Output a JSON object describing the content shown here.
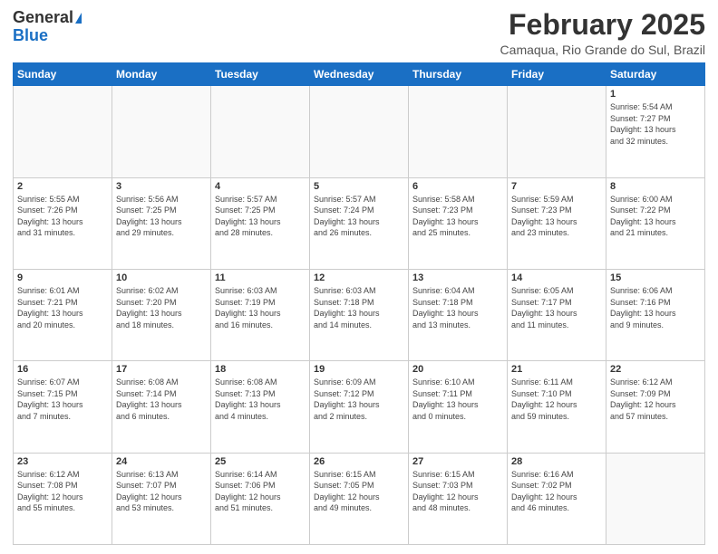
{
  "header": {
    "logo_line1": "General",
    "logo_line2": "Blue",
    "month": "February 2025",
    "location": "Camaqua, Rio Grande do Sul, Brazil"
  },
  "weekdays": [
    "Sunday",
    "Monday",
    "Tuesday",
    "Wednesday",
    "Thursday",
    "Friday",
    "Saturday"
  ],
  "weeks": [
    [
      {
        "day": "",
        "info": ""
      },
      {
        "day": "",
        "info": ""
      },
      {
        "day": "",
        "info": ""
      },
      {
        "day": "",
        "info": ""
      },
      {
        "day": "",
        "info": ""
      },
      {
        "day": "",
        "info": ""
      },
      {
        "day": "1",
        "info": "Sunrise: 5:54 AM\nSunset: 7:27 PM\nDaylight: 13 hours\nand 32 minutes."
      }
    ],
    [
      {
        "day": "2",
        "info": "Sunrise: 5:55 AM\nSunset: 7:26 PM\nDaylight: 13 hours\nand 31 minutes."
      },
      {
        "day": "3",
        "info": "Sunrise: 5:56 AM\nSunset: 7:25 PM\nDaylight: 13 hours\nand 29 minutes."
      },
      {
        "day": "4",
        "info": "Sunrise: 5:57 AM\nSunset: 7:25 PM\nDaylight: 13 hours\nand 28 minutes."
      },
      {
        "day": "5",
        "info": "Sunrise: 5:57 AM\nSunset: 7:24 PM\nDaylight: 13 hours\nand 26 minutes."
      },
      {
        "day": "6",
        "info": "Sunrise: 5:58 AM\nSunset: 7:23 PM\nDaylight: 13 hours\nand 25 minutes."
      },
      {
        "day": "7",
        "info": "Sunrise: 5:59 AM\nSunset: 7:23 PM\nDaylight: 13 hours\nand 23 minutes."
      },
      {
        "day": "8",
        "info": "Sunrise: 6:00 AM\nSunset: 7:22 PM\nDaylight: 13 hours\nand 21 minutes."
      }
    ],
    [
      {
        "day": "9",
        "info": "Sunrise: 6:01 AM\nSunset: 7:21 PM\nDaylight: 13 hours\nand 20 minutes."
      },
      {
        "day": "10",
        "info": "Sunrise: 6:02 AM\nSunset: 7:20 PM\nDaylight: 13 hours\nand 18 minutes."
      },
      {
        "day": "11",
        "info": "Sunrise: 6:03 AM\nSunset: 7:19 PM\nDaylight: 13 hours\nand 16 minutes."
      },
      {
        "day": "12",
        "info": "Sunrise: 6:03 AM\nSunset: 7:18 PM\nDaylight: 13 hours\nand 14 minutes."
      },
      {
        "day": "13",
        "info": "Sunrise: 6:04 AM\nSunset: 7:18 PM\nDaylight: 13 hours\nand 13 minutes."
      },
      {
        "day": "14",
        "info": "Sunrise: 6:05 AM\nSunset: 7:17 PM\nDaylight: 13 hours\nand 11 minutes."
      },
      {
        "day": "15",
        "info": "Sunrise: 6:06 AM\nSunset: 7:16 PM\nDaylight: 13 hours\nand 9 minutes."
      }
    ],
    [
      {
        "day": "16",
        "info": "Sunrise: 6:07 AM\nSunset: 7:15 PM\nDaylight: 13 hours\nand 7 minutes."
      },
      {
        "day": "17",
        "info": "Sunrise: 6:08 AM\nSunset: 7:14 PM\nDaylight: 13 hours\nand 6 minutes."
      },
      {
        "day": "18",
        "info": "Sunrise: 6:08 AM\nSunset: 7:13 PM\nDaylight: 13 hours\nand 4 minutes."
      },
      {
        "day": "19",
        "info": "Sunrise: 6:09 AM\nSunset: 7:12 PM\nDaylight: 13 hours\nand 2 minutes."
      },
      {
        "day": "20",
        "info": "Sunrise: 6:10 AM\nSunset: 7:11 PM\nDaylight: 13 hours\nand 0 minutes."
      },
      {
        "day": "21",
        "info": "Sunrise: 6:11 AM\nSunset: 7:10 PM\nDaylight: 12 hours\nand 59 minutes."
      },
      {
        "day": "22",
        "info": "Sunrise: 6:12 AM\nSunset: 7:09 PM\nDaylight: 12 hours\nand 57 minutes."
      }
    ],
    [
      {
        "day": "23",
        "info": "Sunrise: 6:12 AM\nSunset: 7:08 PM\nDaylight: 12 hours\nand 55 minutes."
      },
      {
        "day": "24",
        "info": "Sunrise: 6:13 AM\nSunset: 7:07 PM\nDaylight: 12 hours\nand 53 minutes."
      },
      {
        "day": "25",
        "info": "Sunrise: 6:14 AM\nSunset: 7:06 PM\nDaylight: 12 hours\nand 51 minutes."
      },
      {
        "day": "26",
        "info": "Sunrise: 6:15 AM\nSunset: 7:05 PM\nDaylight: 12 hours\nand 49 minutes."
      },
      {
        "day": "27",
        "info": "Sunrise: 6:15 AM\nSunset: 7:03 PM\nDaylight: 12 hours\nand 48 minutes."
      },
      {
        "day": "28",
        "info": "Sunrise: 6:16 AM\nSunset: 7:02 PM\nDaylight: 12 hours\nand 46 minutes."
      },
      {
        "day": "",
        "info": ""
      }
    ]
  ]
}
